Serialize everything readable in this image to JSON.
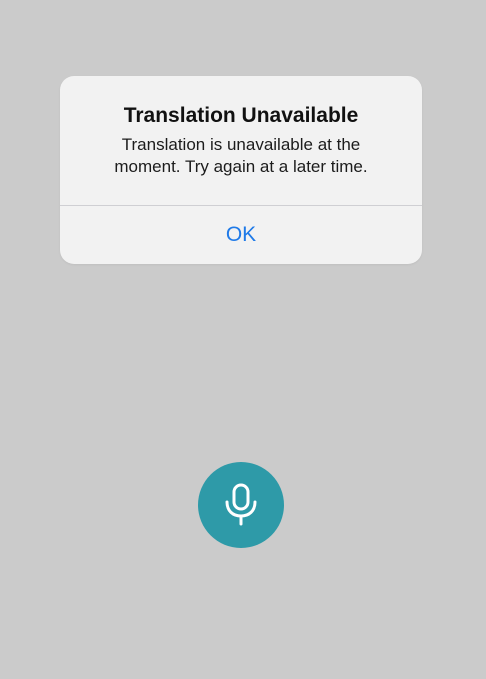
{
  "alert": {
    "title": "Translation Unavailable",
    "message_line1": "Translation is unavailable at the",
    "message_line2": "moment. Try again at a later time.",
    "ok_label": "OK"
  },
  "mic_button": {
    "icon": "microphone-icon"
  },
  "colors": {
    "background": "#cbcbcb",
    "alert_background": "#f2f2f2",
    "button_text": "#1f7ae8",
    "mic_button": "#2e9aa8"
  }
}
